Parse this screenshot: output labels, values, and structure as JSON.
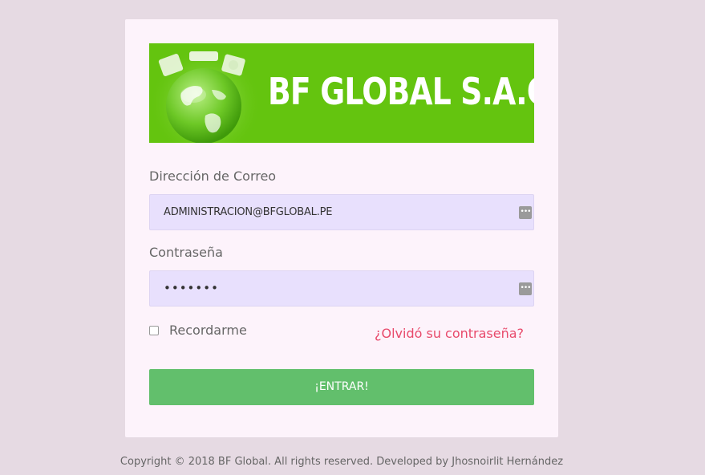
{
  "banner": {
    "brand_text": "BF GLOBAL S.A.C.",
    "background_color": "#64c40f",
    "logo_icon": "globe-with-appliances-icon"
  },
  "form": {
    "email_label": "Dirección de Correo",
    "email_value": "ADMINISTRACION@BFGLOBAL.PE",
    "password_label": "Contraseña",
    "password_value": "•••••••",
    "password_manager_icon": "ellipsis-key-icon",
    "remember_label": "Recordarme",
    "remember_checked": false,
    "forgot_link": "¿Olvidó su contraseña?",
    "submit_label": "¡ENTRAR!"
  },
  "footer": {
    "copyright": "Copyright © 2018 BF Global. All rights reserved. Developed by Jhosnoirlit Hernández"
  },
  "colors": {
    "page_background": "#e6dae3",
    "card_background": "#fdf3fb",
    "input_background": "#e8e0fd",
    "button_color": "#62bf6c",
    "link_color": "#e84a6b"
  }
}
